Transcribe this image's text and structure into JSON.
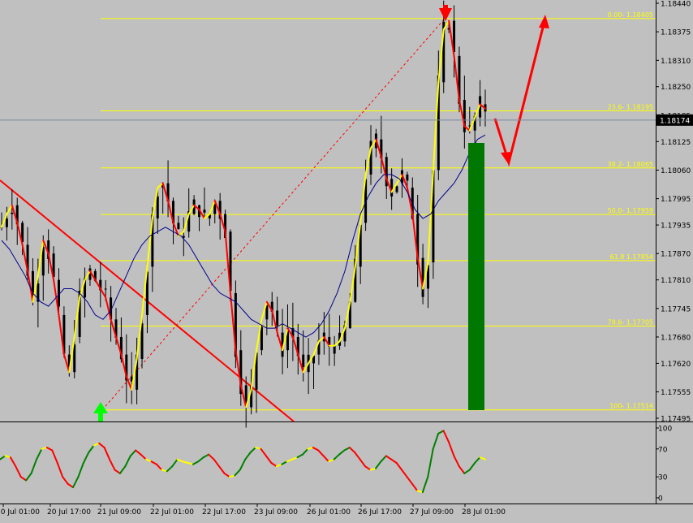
{
  "colors": {
    "background": "#c0c0c0",
    "candle": "#000000",
    "fast_line_up": "#ffff00",
    "fast_line_down": "#ff0000",
    "slow_line": "#00008b",
    "fib_line": "#ffff00",
    "trendline": "#ff0000",
    "green_bar": "#007800",
    "osc_up": "#008000",
    "osc_down": "#ff0000",
    "osc_mid": "#ffff00",
    "arrow_red": "#ff0000",
    "arrow_green": "#00ff00",
    "current_price_box": "#000000"
  },
  "price_axis": {
    "ticks": [
      "1.18440",
      "1.18375",
      "1.18310",
      "1.18250",
      "1.18185",
      "1.18125",
      "1.18060",
      "1.17995",
      "1.17935",
      "1.17870",
      "1.17810",
      "1.17745",
      "1.17680",
      "1.17620",
      "1.17555",
      "1.17495"
    ],
    "current_price": "1.18174"
  },
  "time_axis": {
    "labels": [
      "20 Jul 01:00",
      "20 Jul 17:00",
      "21 Jul 09:00",
      "22 Jul 01:00",
      "22 Jul 17:00",
      "23 Jul 09:00",
      "26 Jul 01:00",
      "26 Jul 17:00",
      "27 Jul 09:00",
      "28 Jul 01:00"
    ]
  },
  "fibonacci": [
    {
      "level": "0.00",
      "label": "0.00- 1.18405",
      "price": 1.18405
    },
    {
      "level": "23.6",
      "label": "23.6- 1.18195",
      "price": 1.18195
    },
    {
      "level": "38.2",
      "label": "38.2- 1.18065",
      "price": 1.18065
    },
    {
      "level": "50.0",
      "label": "50.0- 1.17959",
      "price": 1.17959
    },
    {
      "level": "61.8",
      "label": "61.8 1.17854",
      "price": 1.17854
    },
    {
      "level": "78.6",
      "label": "78.6- 1.17705",
      "price": 1.17705
    },
    {
      "level": "100",
      "label": "100- 1.17514",
      "price": 1.17514
    }
  ],
  "oscillator": {
    "ticks": [
      "100",
      "70",
      "30",
      "0"
    ]
  },
  "chart_data": {
    "type": "candlestick",
    "price_range": [
      1.17495,
      1.1844
    ],
    "fast_line": [
      1.1793,
      1.1796,
      1.1798,
      1.1794,
      1.1789,
      1.1783,
      1.1776,
      1.1782,
      1.179,
      1.1787,
      1.1781,
      1.1773,
      1.1764,
      1.176,
      1.1768,
      1.1777,
      1.1781,
      1.1783,
      1.1781,
      1.1779,
      1.1777,
      1.1772,
      1.1768,
      1.1764,
      1.1759,
      1.1756,
      1.1763,
      1.1773,
      1.1784,
      1.1795,
      1.1802,
      1.1803,
      1.1799,
      1.1794,
      1.1791,
      1.1792,
      1.1796,
      1.1798,
      1.1797,
      1.1795,
      1.1796,
      1.1799,
      1.1796,
      1.1792,
      1.1778,
      1.1765,
      1.1757,
      1.1752,
      1.1756,
      1.1765,
      1.1772,
      1.1776,
      1.1774,
      1.1769,
      1.1765,
      1.177,
      1.1768,
      1.1764,
      1.176,
      1.1762,
      1.1764,
      1.1767,
      1.1768,
      1.1766,
      1.1766,
      1.1767,
      1.177,
      1.1776,
      1.1784,
      1.1794,
      1.1805,
      1.1811,
      1.1813,
      1.1809,
      1.1804,
      1.1801,
      1.1803,
      1.1805,
      1.1802,
      1.1796,
      1.1786,
      1.1779,
      1.1785,
      1.1806,
      1.1826,
      1.1838,
      1.184,
      1.1832,
      1.1822,
      1.1816,
      1.1815,
      1.1818,
      1.1821,
      1.182
    ],
    "slow_line": [
      1.179,
      1.1788,
      1.1785,
      1.1782,
      1.1778,
      1.1776,
      1.1775,
      1.1777,
      1.1779,
      1.1779,
      1.1778,
      1.1776,
      1.1773,
      1.1772,
      1.1774,
      1.1778,
      1.1782,
      1.1786,
      1.1789,
      1.1791,
      1.1792,
      1.1793,
      1.1792,
      1.1791,
      1.1789,
      1.1786,
      1.1783,
      1.178,
      1.1778,
      1.1777,
      1.1776,
      1.1774,
      1.1772,
      1.1771,
      1.177,
      1.177,
      1.1771,
      1.177,
      1.1769,
      1.1768,
      1.1769,
      1.1771,
      1.1774,
      1.1778,
      1.1783,
      1.179,
      1.1796,
      1.18,
      1.1803,
      1.1805,
      1.1805,
      1.1804,
      1.1801,
      1.1797,
      1.1795,
      1.1796,
      1.1799,
      1.1801,
      1.1803,
      1.1806,
      1.181,
      1.1813,
      1.1814
    ],
    "oscillator": [
      55,
      60,
      58,
      45,
      30,
      25,
      35,
      55,
      70,
      72,
      68,
      50,
      30,
      20,
      15,
      30,
      50,
      65,
      75,
      78,
      72,
      55,
      40,
      35,
      45,
      60,
      68,
      62,
      55,
      52,
      48,
      40,
      38,
      45,
      55,
      52,
      50,
      48,
      52,
      58,
      62,
      55,
      45,
      35,
      30,
      32,
      40,
      55,
      65,
      72,
      70,
      60,
      50,
      45,
      48,
      52,
      55,
      58,
      62,
      70,
      72,
      68,
      60,
      52,
      55,
      62,
      68,
      72,
      65,
      55,
      45,
      40,
      42,
      52,
      60,
      55,
      50,
      40,
      30,
      20,
      10,
      8,
      30,
      70,
      92,
      96,
      80,
      60,
      45,
      35,
      40,
      50,
      58,
      55
    ]
  }
}
